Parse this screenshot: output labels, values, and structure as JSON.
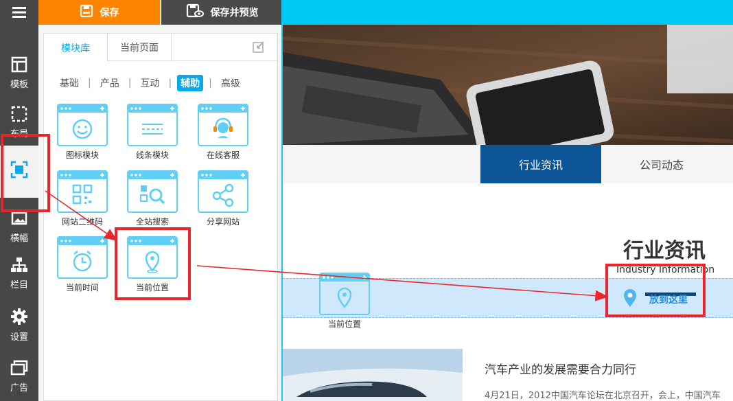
{
  "toolbar": {
    "save_label": "保存",
    "save_preview_label": "保存并预览"
  },
  "rail": {
    "items": [
      {
        "label": "模板",
        "icon": "template-icon"
      },
      {
        "label": "布局",
        "icon": "layout-icon"
      },
      {
        "label": "",
        "icon": "module-icon"
      },
      {
        "label": "横幅",
        "icon": "banner-icon"
      },
      {
        "label": "栏目",
        "icon": "sitemap-icon"
      },
      {
        "label": "设置",
        "icon": "gear-icon"
      },
      {
        "label": "广告",
        "icon": "ad-icon"
      }
    ]
  },
  "panel": {
    "tabs": [
      {
        "label": "模块库"
      },
      {
        "label": "当前页面"
      }
    ],
    "categories": [
      "基础",
      "产品",
      "互动",
      "辅助",
      "高级"
    ],
    "active_category": "辅助",
    "modules": [
      {
        "label": "图标模块",
        "icon": "smiley-icon"
      },
      {
        "label": "线条模块",
        "icon": "lines-icon"
      },
      {
        "label": "在线客服",
        "icon": "headset-icon"
      },
      {
        "label": "网站二维码",
        "icon": "qrcode-icon"
      },
      {
        "label": "全站搜索",
        "icon": "search-icon"
      },
      {
        "label": "分享网站",
        "icon": "share-icon"
      },
      {
        "label": "当前时间",
        "icon": "clock-icon"
      },
      {
        "label": "当前位置",
        "icon": "location-pin-icon"
      }
    ]
  },
  "canvas": {
    "nav": [
      "行业资讯",
      "公司动态"
    ],
    "section_title": "行业资讯",
    "section_subtitle": "Industry Information",
    "drop_label": "放到这里",
    "dragged_module_label": "当前位置",
    "news": {
      "title": "汽车产业的发展需要合力同行",
      "desc": "4月21日，2012中国汽车论坛在北京召开，会上，中国汽车"
    }
  },
  "colors": {
    "accent": "#0aa9e5",
    "save": "#ff8400",
    "nav_active": "#0c5596",
    "annotation": "#e8262b"
  }
}
